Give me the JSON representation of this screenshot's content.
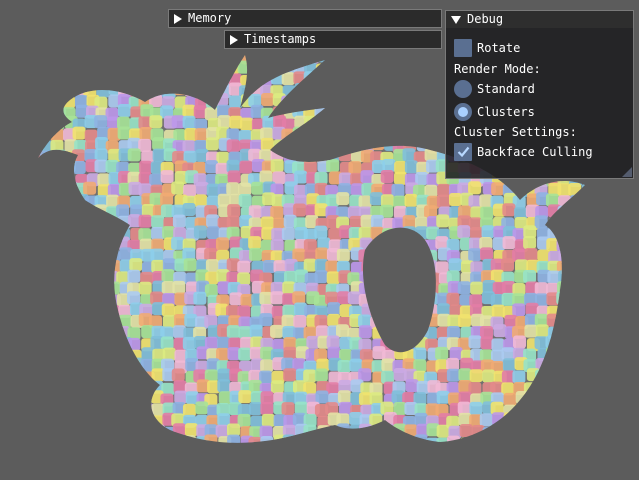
{
  "windows": {
    "memory": {
      "title": "Memory",
      "collapsed": true
    },
    "timestamps": {
      "title": "Timestamps",
      "collapsed": true
    },
    "debug": {
      "title": "Debug",
      "collapsed": false,
      "rotate_label": "Rotate",
      "rotate_checked": false,
      "render_mode_heading": "Render Mode:",
      "render_modes": [
        {
          "label": "Standard",
          "selected": false
        },
        {
          "label": "Clusters",
          "selected": true
        }
      ],
      "cluster_settings_heading": "Cluster Settings:",
      "backface_culling_label": "Backface Culling",
      "backface_culling_checked": true
    }
  },
  "scene": {
    "background_color": "#5c5c5c",
    "model": "dragon",
    "cluster_colors": [
      "#e06c9a",
      "#f0e05a",
      "#7ec9e8",
      "#b48ae8",
      "#9be08a",
      "#f0a060",
      "#6fb7d6",
      "#e0e09a",
      "#c4a0e0",
      "#8ae0c0",
      "#e07a7a",
      "#a0c4f0",
      "#f0b0d0",
      "#d8e870",
      "#80a8e0"
    ]
  },
  "colors": {
    "accent": "#5a6f91",
    "radio_selected": "#a9d0ff",
    "window_bg": "#1c1c1e",
    "header_bg": "#2b2b2b",
    "text": "#ffffff"
  },
  "icons": {
    "collapsed_arrow": "triangle-right",
    "expanded_arrow": "triangle-down",
    "check": "checkmark"
  }
}
